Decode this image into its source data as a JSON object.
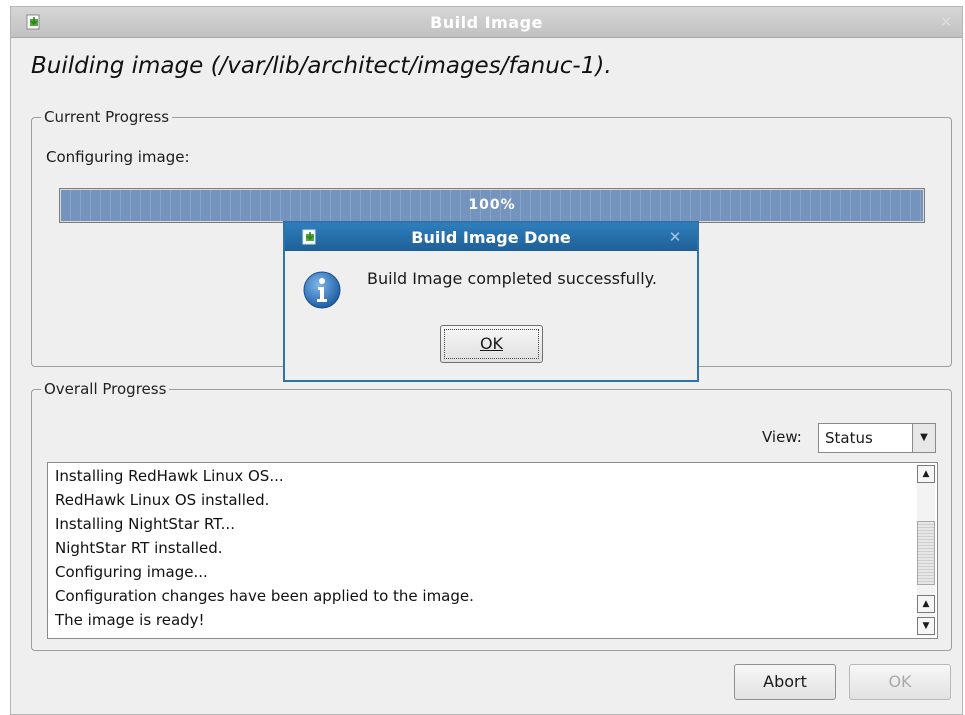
{
  "window": {
    "title": "Build Image",
    "close_glyph": "✕"
  },
  "heading": "Building image (/var/lib/architect/images/fanuc-1).",
  "current_progress": {
    "legend": "Current Progress",
    "status_text": "Configuring image:",
    "progress_label": "100%",
    "progress_fraction": 1.0
  },
  "overall_progress": {
    "legend": "Overall Progress",
    "view_label": "View:",
    "view_selected": "Status",
    "log_lines": [
      "Installing RedHawk Linux OS...",
      "RedHawk Linux OS installed.",
      "Installing NightStar RT...",
      "NightStar RT installed.",
      "Configuring image...",
      "Configuration changes have been applied to the image.",
      "The image is ready!"
    ]
  },
  "buttons": {
    "abort": "Abort",
    "ok": "OK"
  },
  "dialog": {
    "title": "Build Image Done",
    "message": "Build Image completed successfully.",
    "ok_label": "OK",
    "close_glyph": "✕"
  },
  "icons": {
    "window_icon": "app-install-icon",
    "dialog_icon": "app-install-icon",
    "info": "info-icon",
    "dropdown": "chevron-down-icon",
    "scroll_up": "arrow-up-icon",
    "scroll_down": "arrow-down-icon"
  },
  "colors": {
    "dialog_title_bg": "#2f7fbd",
    "progress_fill": "#7494bd",
    "window_title_bg": "#c8c8c8"
  }
}
